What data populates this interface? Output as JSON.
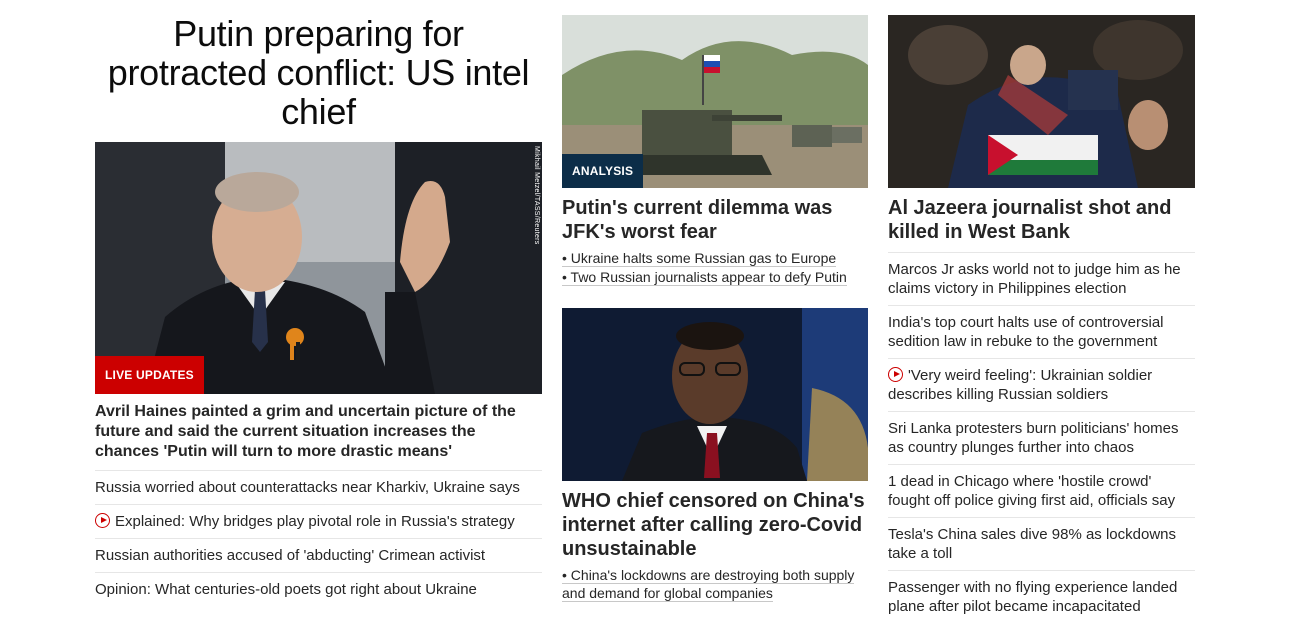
{
  "left": {
    "headline": "Putin preparing for protracted conflict: US intel chief",
    "badge": "LIVE UPDATES",
    "photo_credit": "Mikhail Metzel/TASS/Reuters",
    "description": "Avril Haines painted a grim and uncertain picture of the future and said the current situation increases the chances 'Putin will turn to more drastic means'",
    "links": [
      {
        "text": "Russia worried about counterattacks near Kharkiv, Ukraine says",
        "video": false
      },
      {
        "text": "Explained: Why bridges play pivotal role in Russia's strategy",
        "video": true
      },
      {
        "text": "Russian authorities accused of 'abducting' Crimean activist",
        "video": false
      },
      {
        "text": "Opinion: What centuries-old poets got right about Ukraine",
        "video": false
      }
    ]
  },
  "middle": {
    "story1": {
      "badge": "ANALYSIS",
      "headline": "Putin's current dilemma was JFK's worst fear",
      "bullets": [
        "Ukraine halts some Russian gas to Europe",
        "Two Russian journalists appear to defy Putin"
      ]
    },
    "story2": {
      "headline": "WHO chief censored on China's internet after calling zero-Covid unsustainable",
      "bullets": [
        "China's lockdowns are destroying both supply and demand for global companies"
      ]
    }
  },
  "right": {
    "headline": "Al Jazeera journalist shot and killed in West Bank",
    "links": [
      {
        "text": "Marcos Jr asks world not to judge him as he claims victory in Philippines election",
        "video": false
      },
      {
        "text": "India's top court halts use of controversial sedition law in rebuke to the government",
        "video": false
      },
      {
        "text": "'Very weird feeling': Ukrainian soldier describes killing Russian soldiers",
        "video": true
      },
      {
        "text": "Sri Lanka protesters burn politicians' homes as country plunges further into chaos",
        "video": false
      },
      {
        "text": "1 dead in Chicago where 'hostile crowd' fought off police giving first aid, officials say",
        "video": false
      },
      {
        "text": "Tesla's China sales dive 98% as lockdowns take a toll",
        "video": false
      },
      {
        "text": "Passenger with no flying experience landed plane after pilot became incapacitated",
        "video": false
      }
    ]
  },
  "colors": {
    "live_badge": "#cc0000",
    "analysis_badge": "#0c2d48",
    "play_icon": "#cc0000"
  }
}
